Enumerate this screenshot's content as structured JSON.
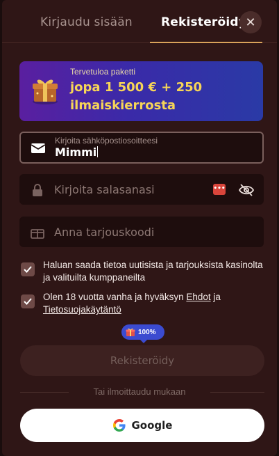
{
  "tabs": {
    "login": "Kirjaudu sisään",
    "register": "Rekisteröidy"
  },
  "promo": {
    "subtitle": "Tervetuloa paketti",
    "headline": "jopa 1 500 € + 250 ilmaiskierrosta"
  },
  "email": {
    "label": "Kirjoita sähköpostiosoitteesi",
    "value": "Mimmi"
  },
  "password": {
    "placeholder": "Kirjoita salasanasi",
    "badge": "•••"
  },
  "promo_code": {
    "placeholder": "Anna tarjouskoodi"
  },
  "consents": {
    "news": "Haluan saada tietoa uutisista ja tarjouksista kasinolta ja valituilta kumppaneilta",
    "age_prefix": "Olen 18 vuotta vanha ja hyväksyn ",
    "terms_link": "Ehdot",
    "age_mid": " ja ",
    "privacy_link": "Tietosuojakäytäntö"
  },
  "progress": {
    "label": "100%",
    "value": 100
  },
  "register_button": "Rekisteröidy",
  "divider": "Tai ilmoittaudu mukaan",
  "google_button": "Google",
  "colors": {
    "accent_gold": "#d9a25a",
    "promo_text": "#f7d557",
    "background": "#2f1616"
  }
}
